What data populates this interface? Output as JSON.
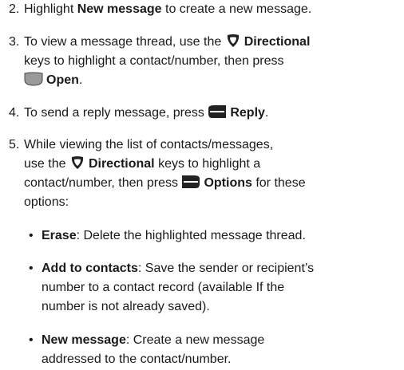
{
  "steps": [
    {
      "num": "2.",
      "pre": "Highlight ",
      "bold": "New message",
      "post": " to create a new message."
    },
    {
      "num": "3.",
      "line1_pre": "To view a message thread, use the ",
      "line1_bold": "Directional",
      "line2": "keys to highlight a contact/number, then press",
      "line3_bold": "Open",
      "line3_post": "."
    },
    {
      "num": "4.",
      "pre": "To send a reply message, press ",
      "bold": "Reply",
      "post": "."
    },
    {
      "num": "5.",
      "line1": "While viewing the list of contacts/messages,",
      "line2_pre": "use the ",
      "line2_bold": "Directional",
      "line2_post": " keys to highlight a",
      "line3_pre": "contact/number, then press ",
      "line3_bold": "Options",
      "line3_post": " for these",
      "line4": "options:"
    }
  ],
  "bullets": [
    {
      "dot": "•",
      "bold": "Erase",
      "text": ": Delete the highlighted message thread."
    },
    {
      "dot": "•",
      "bold": "Add to contacts",
      "line1": ": Save the sender or recipient’s",
      "line2": "number to a contact record (available If the",
      "line3": "number is not already saved)."
    },
    {
      "dot": "•",
      "bold": "New message",
      "line1": ": Create a new message",
      "line2": "addressed to the contact/number."
    }
  ],
  "icons": {
    "directional": "directional-key-icon",
    "open": "center-open-key-icon",
    "reply": "left-softkey-icon",
    "options": "right-softkey-icon"
  }
}
